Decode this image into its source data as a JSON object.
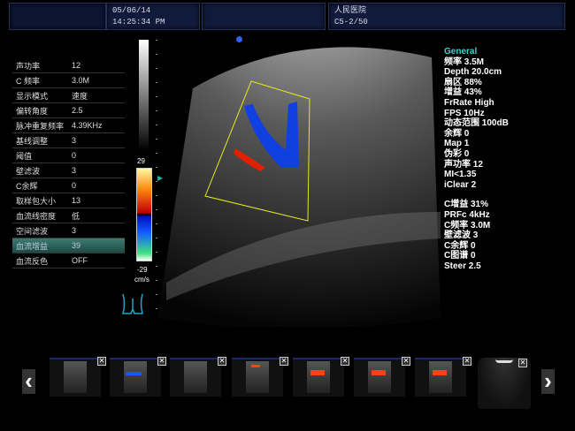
{
  "header": {
    "date": "05/06/14",
    "time": "14:25:34 PM",
    "hospital": "人民医院",
    "probe": "C5-2/50"
  },
  "left_panel": {
    "rows": [
      {
        "label": "声功率",
        "value": "12"
      },
      {
        "label": "C 频率",
        "value": "3.0M"
      },
      {
        "label": "显示模式",
        "value": "速度"
      },
      {
        "label": "偏转角度",
        "value": "2.5"
      },
      {
        "label": "脉冲重复频率",
        "value": "4.39KHz"
      },
      {
        "label": "基线调整",
        "value": "3"
      },
      {
        "label": "阈值",
        "value": "0"
      },
      {
        "label": "壁滤波",
        "value": "3"
      },
      {
        "label": "C余辉",
        "value": "0"
      },
      {
        "label": "取样包大小",
        "value": "13"
      },
      {
        "label": "血流线密度",
        "value": "低"
      },
      {
        "label": "空间滤波",
        "value": "3"
      },
      {
        "label": "血流增益",
        "value": "39",
        "selected": true
      },
      {
        "label": "血流反色",
        "value": "OFF"
      }
    ]
  },
  "colorbar": {
    "max": "29",
    "min": "-29",
    "unit": "cm/s"
  },
  "right_panel": {
    "title": "General",
    "title_color": "#40d0c8",
    "lines": [
      "频率 3.5M",
      "Depth 20.0cm",
      "扇区 88%",
      "增益 43%",
      "FrRate High",
      "FPS 10Hz",
      "动态范围 100dB",
      "余辉 0",
      "Map 1",
      "伪彩 0",
      "声功率 12",
      "MI<1.35",
      "iClear 2"
    ],
    "color_lines": [
      "C增益 31%",
      "PRFc 4kHz",
      "C频率 3.0M",
      "壁滤波 3",
      "C余辉 0",
      "C图谱 0",
      "Steer 2.5"
    ]
  },
  "thumbnails": [
    {
      "type": "gray"
    },
    {
      "type": "color-blue"
    },
    {
      "type": "gray"
    },
    {
      "type": "doppler"
    },
    {
      "type": "color-red"
    },
    {
      "type": "color-red"
    },
    {
      "type": "color-red"
    }
  ],
  "icons": {
    "prev": "chevron-left-icon",
    "next": "chevron-right-icon",
    "close": "close-icon",
    "body": "body-marker-icon",
    "probe": "probe-icon"
  },
  "symbols": {
    "prev": "‹",
    "next": "›",
    "close": "✕"
  }
}
